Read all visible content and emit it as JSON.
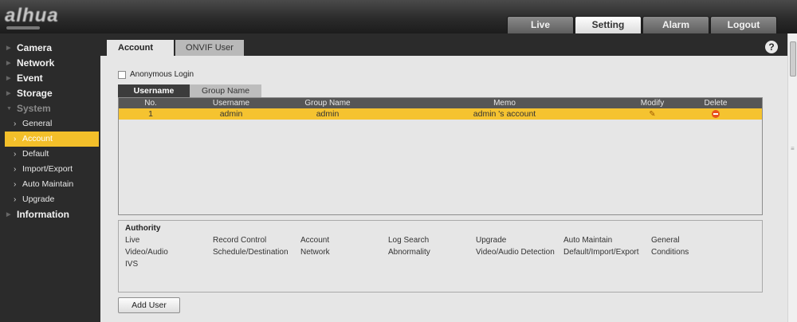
{
  "header": {
    "logo_text": "alhua",
    "tabs": [
      {
        "label": "Live",
        "active": false
      },
      {
        "label": "Setting",
        "active": true
      },
      {
        "label": "Alarm",
        "active": false
      },
      {
        "label": "Logout",
        "active": false
      }
    ]
  },
  "sidebar": {
    "items": [
      {
        "label": "Camera",
        "type": "main"
      },
      {
        "label": "Network",
        "type": "main"
      },
      {
        "label": "Event",
        "type": "main"
      },
      {
        "label": "Storage",
        "type": "main"
      },
      {
        "label": "System",
        "type": "main",
        "expanded": true
      },
      {
        "label": "General",
        "type": "sub"
      },
      {
        "label": "Account",
        "type": "sub",
        "active": true
      },
      {
        "label": "Default",
        "type": "sub"
      },
      {
        "label": "Import/Export",
        "type": "sub"
      },
      {
        "label": "Auto Maintain",
        "type": "sub"
      },
      {
        "label": "Upgrade",
        "type": "sub"
      },
      {
        "label": "Information",
        "type": "main"
      }
    ]
  },
  "content": {
    "tabs": [
      {
        "label": "Account",
        "active": true
      },
      {
        "label": "ONVIF User",
        "active": false
      }
    ],
    "anonymous_login_label": "Anonymous Login",
    "anonymous_login_checked": false,
    "sub_tabs": [
      {
        "label": "Username",
        "active": true
      },
      {
        "label": "Group Name",
        "active": false
      }
    ],
    "table": {
      "headers": {
        "no": "No.",
        "username": "Username",
        "group": "Group Name",
        "memo": "Memo",
        "modify": "Modify",
        "delete": "Delete"
      },
      "rows": [
        {
          "no": "1",
          "username": "admin",
          "group": "admin",
          "memo": "admin 's account"
        }
      ]
    },
    "authority": {
      "title": "Authority",
      "items": [
        "Live",
        "Record Control",
        "Account",
        "Log Search",
        "Upgrade",
        "Auto Maintain",
        "General",
        "Video/Audio",
        "Schedule/Destination",
        "Network",
        "Abnormality",
        "Video/Audio Detection",
        "Default/Import/Export",
        "Conditions",
        "IVS"
      ]
    },
    "add_user_label": "Add User",
    "help_label": "?"
  },
  "colors": {
    "highlight": "#f5c330",
    "sidebar_active": "#f3bf2a",
    "dark_bg": "#2b2b2b",
    "panel_bg": "#e6e6e6"
  }
}
